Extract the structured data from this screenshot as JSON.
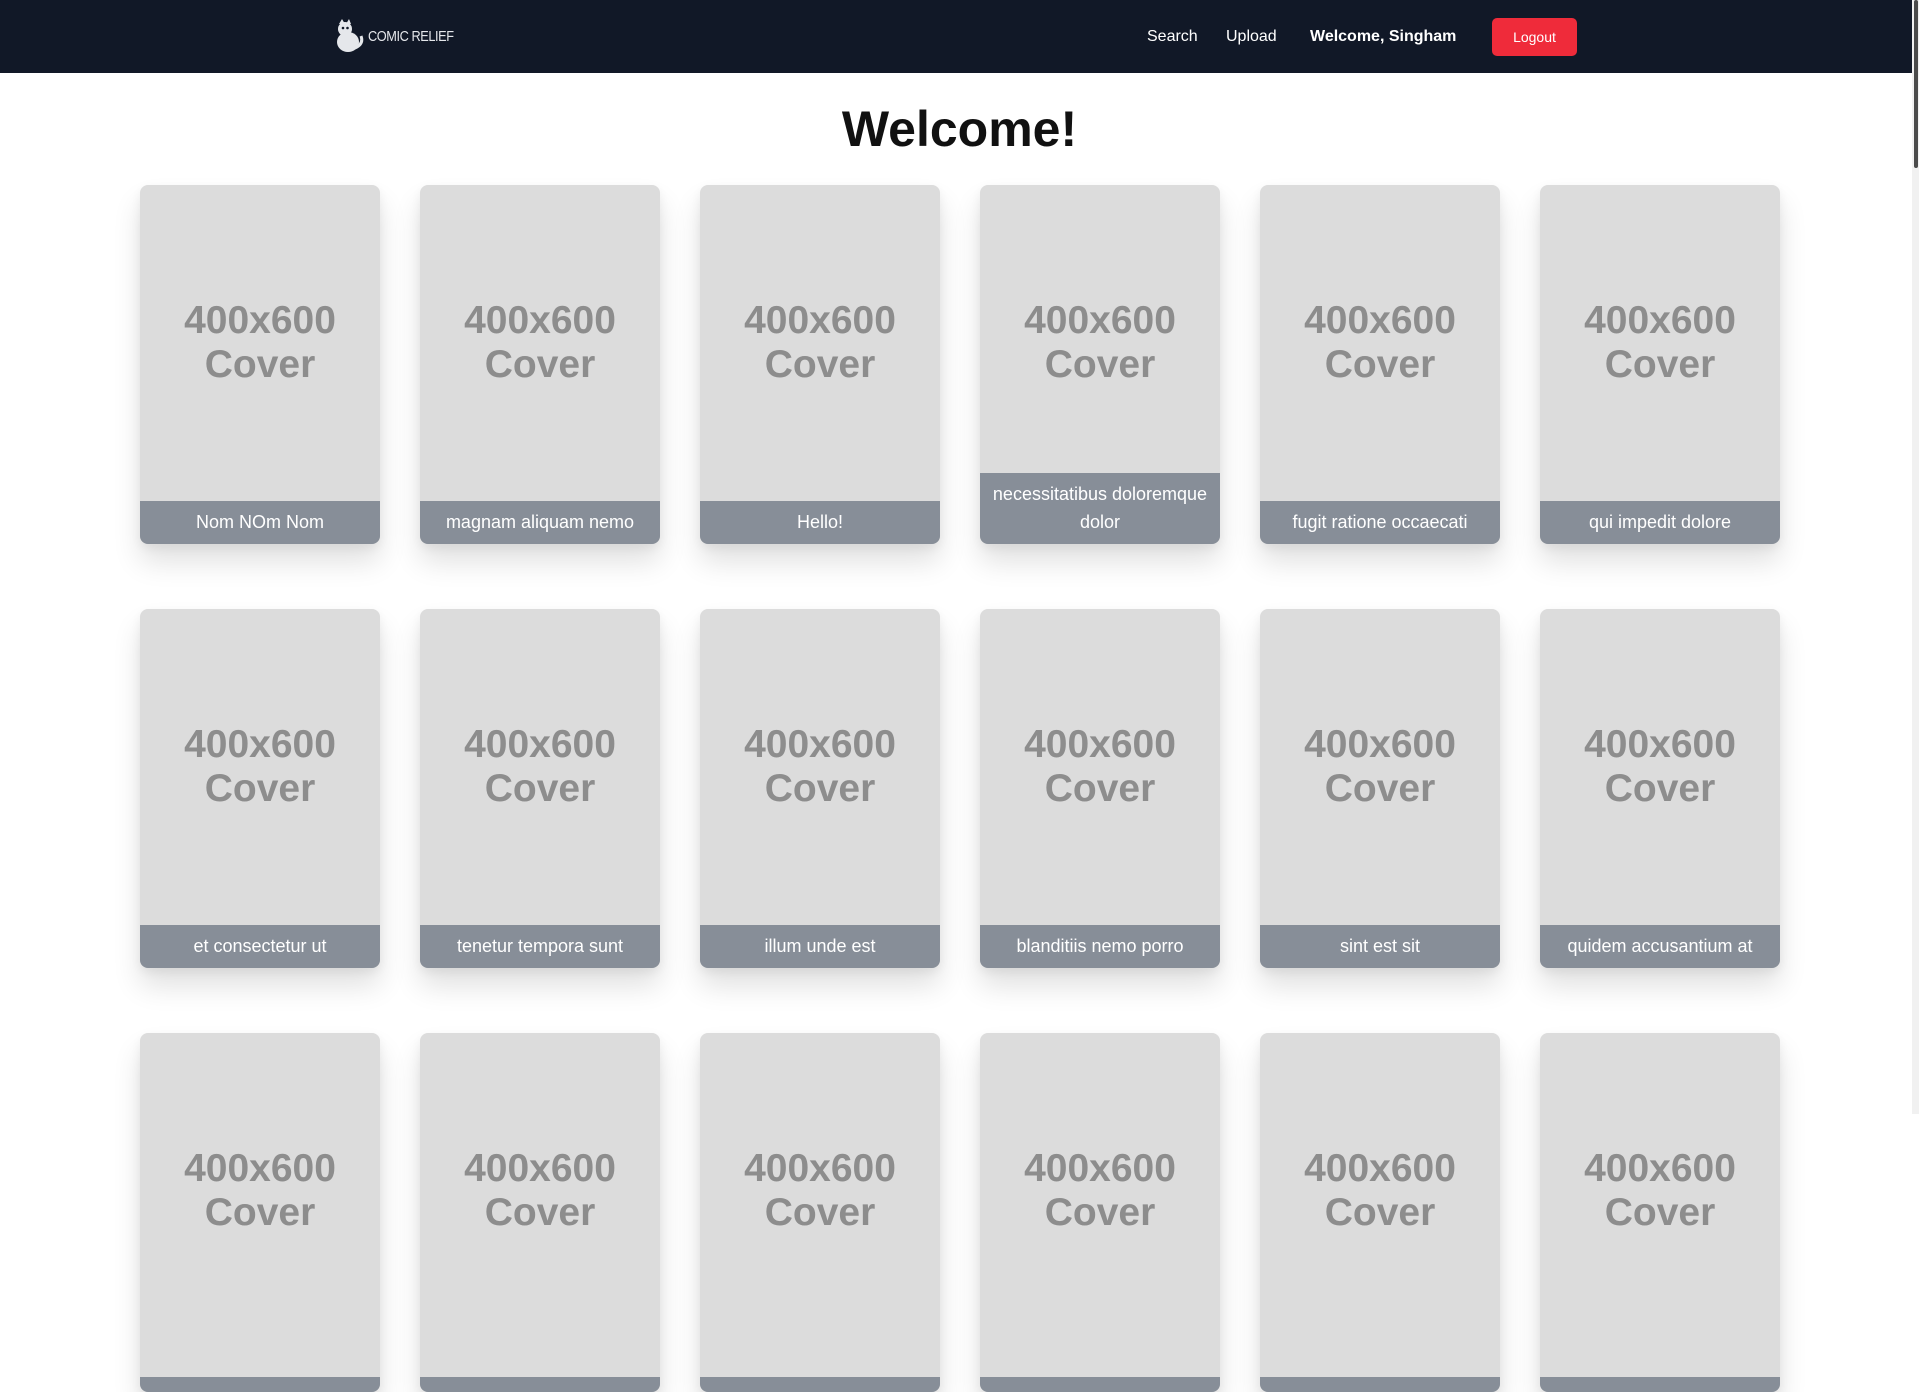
{
  "navbar": {
    "brand_text": "Comic Relief",
    "links": {
      "search": "Search",
      "upload": "Upload"
    },
    "welcome_text": "Welcome, Singham",
    "logout_label": "Logout"
  },
  "page": {
    "title": "Welcome!"
  },
  "cover_placeholder": "400x600\nCover",
  "comics": [
    {
      "title": "Nom NOm Nom"
    },
    {
      "title": "magnam aliquam nemo"
    },
    {
      "title": "Hello!"
    },
    {
      "title": "necessitatibus doloremque dolor"
    },
    {
      "title": "fugit ratione occaecati"
    },
    {
      "title": "qui impedit dolore"
    },
    {
      "title": "et consectetur ut"
    },
    {
      "title": "tenetur tempora sunt"
    },
    {
      "title": "illum unde est"
    },
    {
      "title": "blanditiis nemo porro"
    },
    {
      "title": "sint est sit"
    },
    {
      "title": "quidem accusantium at"
    },
    {
      "title": ""
    },
    {
      "title": ""
    },
    {
      "title": ""
    },
    {
      "title": ""
    },
    {
      "title": ""
    },
    {
      "title": ""
    }
  ],
  "colors": {
    "navbar": "#111827",
    "logout": "#ef2b3a",
    "caption": "#878e98",
    "cover": "#dcdcdc"
  }
}
